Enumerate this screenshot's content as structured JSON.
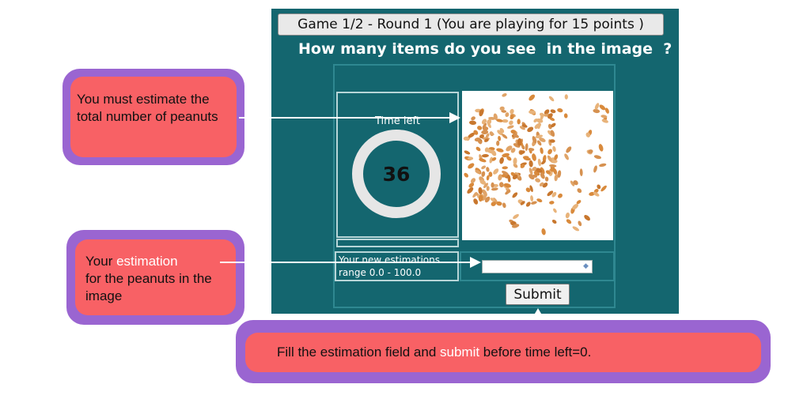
{
  "game": {
    "round_header": "Game 1/2 - Round 1 (You are playing for 15 points )",
    "question": "How many items do you see  in the image  ?",
    "timer_label": "Time left",
    "timer_value": "36",
    "estimate_label_line1": "Your new estimations",
    "estimate_label_line2": "range 0.0 - 100.0",
    "estimate_value": "",
    "submit_label": "Submit"
  },
  "annotations": {
    "peanuts_callout": "You must estimate the total number of peanuts",
    "estimation_callout_prefix": "Your ",
    "estimation_callout_highlight": "estimation",
    "estimation_callout_rest": "for the peanuts in the image",
    "submit_callout_prefix": "Fill the estimation field and ",
    "submit_callout_highlight": "submit",
    "submit_callout_suffix": " before time left=0."
  },
  "colors": {
    "panel_bg": "#14666f",
    "callout_border": "#9a65d1",
    "callout_fill": "#f86165",
    "peanut": "#d98a3c"
  },
  "icons": {
    "spin": "spin-arrows-icon"
  }
}
